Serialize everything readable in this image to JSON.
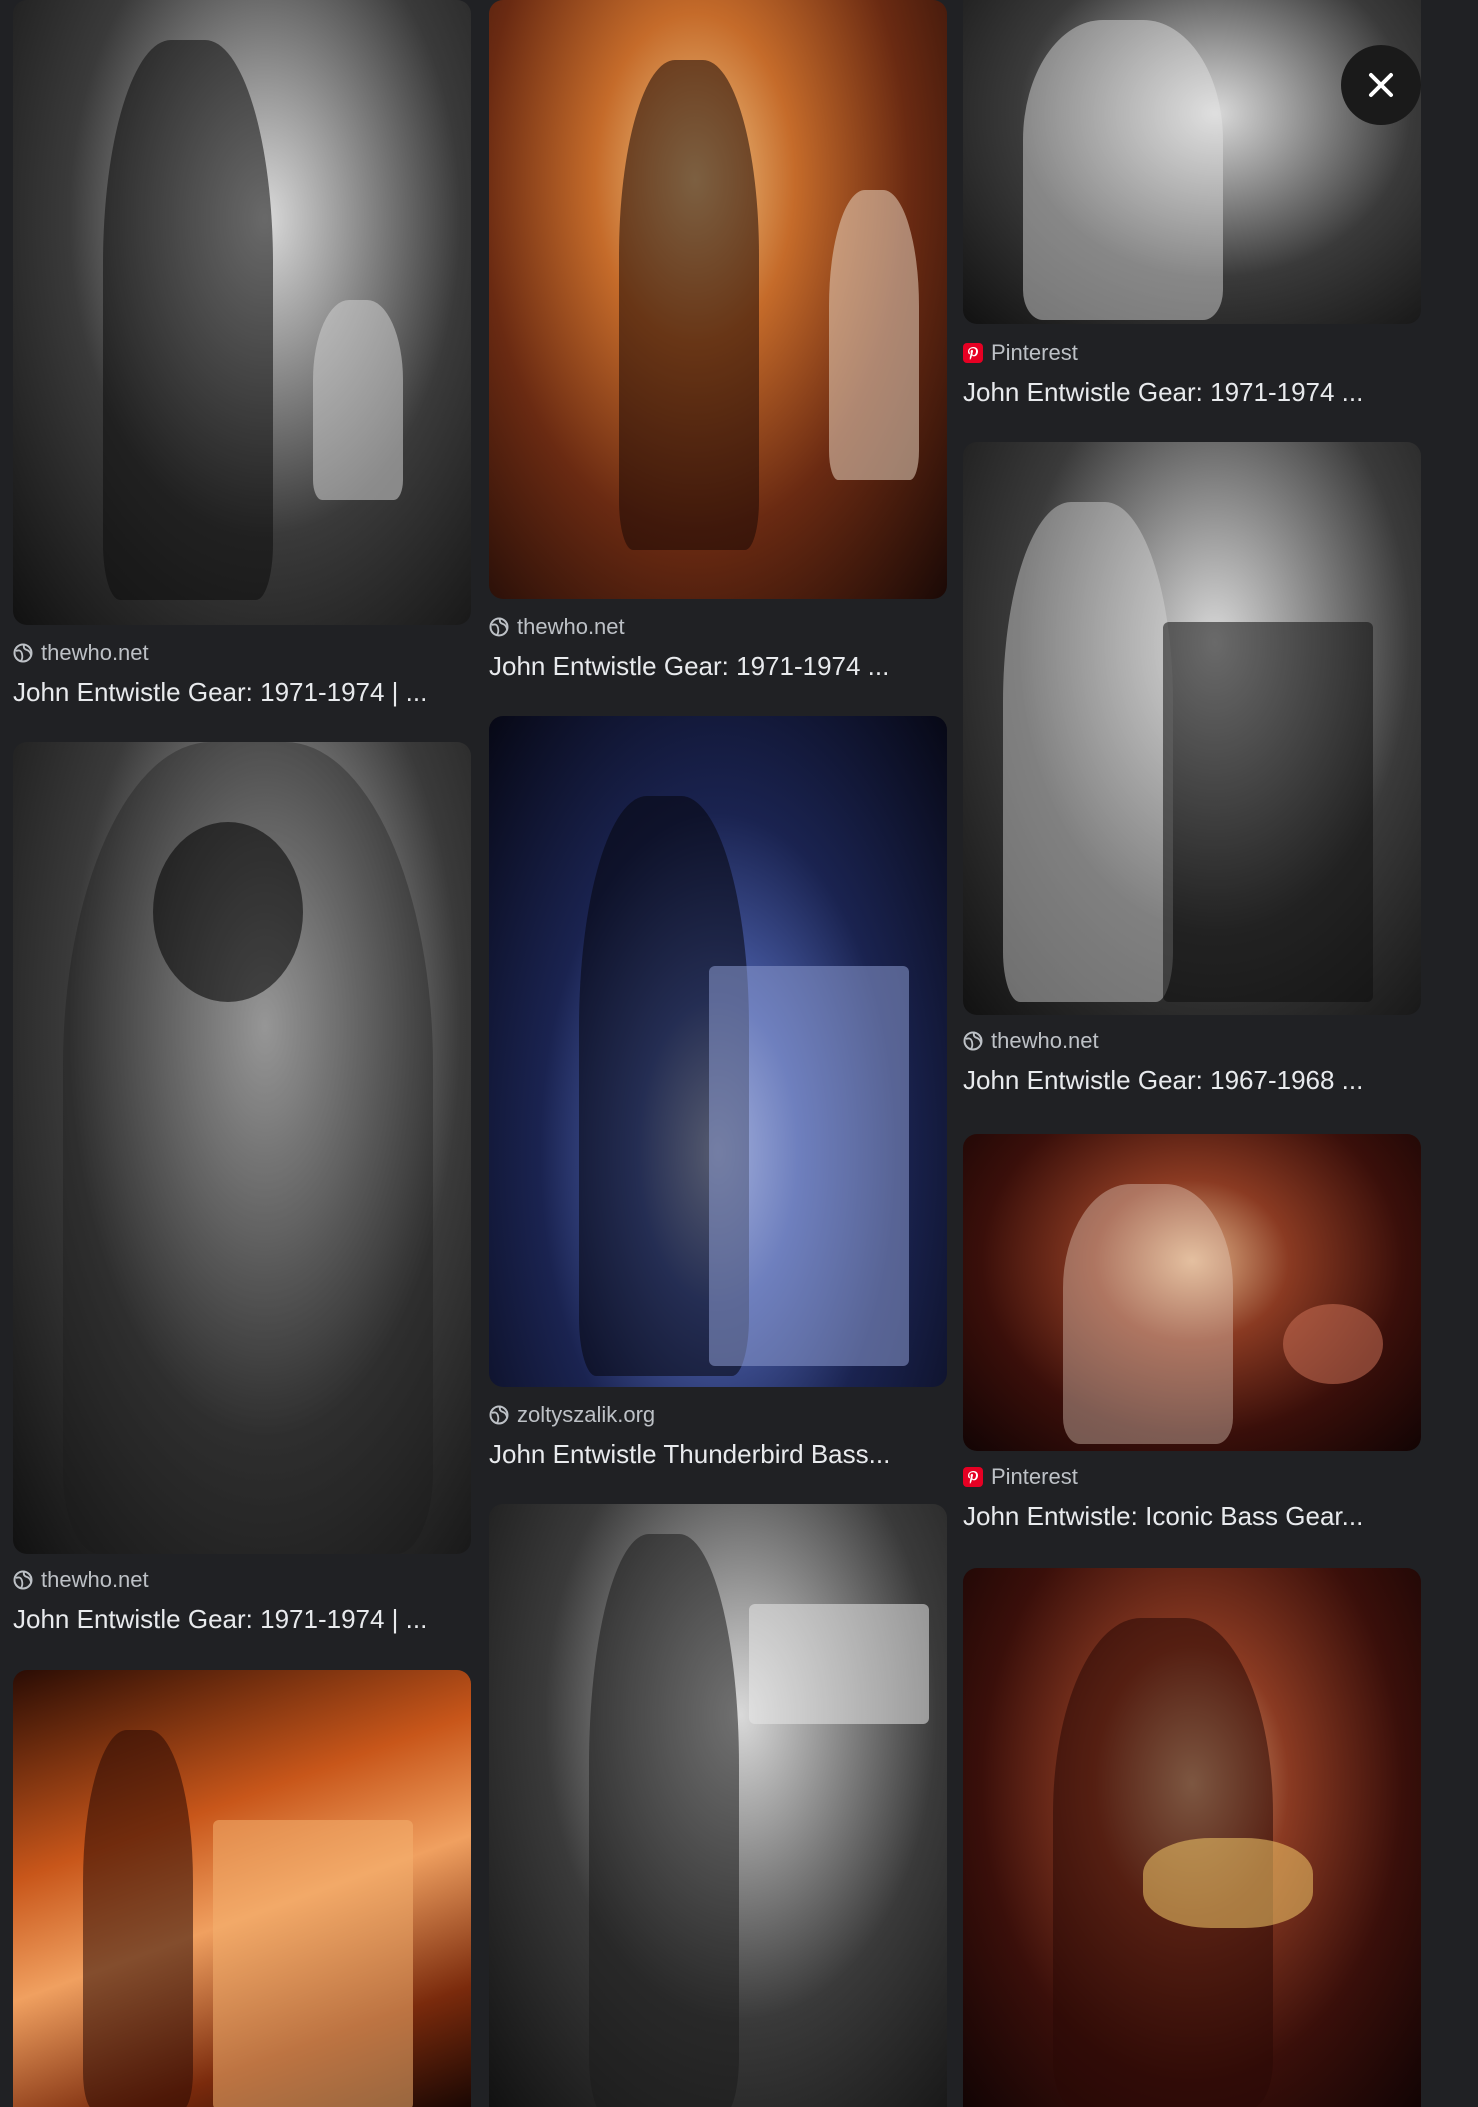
{
  "close_button": {
    "label": "Close",
    "icon": "close-icon"
  },
  "colors": {
    "background": "#202124",
    "title_text": "#e8eaed",
    "source_text": "#bdc1c6",
    "pinterest_red": "#e60023"
  },
  "results": [
    {
      "source": "thewho.net",
      "source_icon": "globe-icon",
      "title": "John Entwistle Gear: 1971-1974 | ..."
    },
    {
      "source": "thewho.net",
      "source_icon": "globe-icon",
      "title": "John Entwistle Gear: 1971-1974 | ..."
    },
    {
      "source": "",
      "source_icon": "",
      "title": ""
    },
    {
      "source": "thewho.net",
      "source_icon": "globe-icon",
      "title": "John Entwistle Gear: 1971-1974 ..."
    },
    {
      "source": "zoltyszalik.org",
      "source_icon": "globe-icon",
      "title": "John Entwistle Thunderbird Bass..."
    },
    {
      "source": "",
      "source_icon": "",
      "title": ""
    },
    {
      "source": "Pinterest",
      "source_icon": "pinterest-icon",
      "title": "John Entwistle Gear: 1971-1974 ..."
    },
    {
      "source": "thewho.net",
      "source_icon": "globe-icon",
      "title": "John Entwistle Gear: 1967-1968 ..."
    },
    {
      "source": "Pinterest",
      "source_icon": "pinterest-icon",
      "title": "John Entwistle: Iconic Bass Gear..."
    },
    {
      "source": "",
      "source_icon": "",
      "title": ""
    }
  ]
}
